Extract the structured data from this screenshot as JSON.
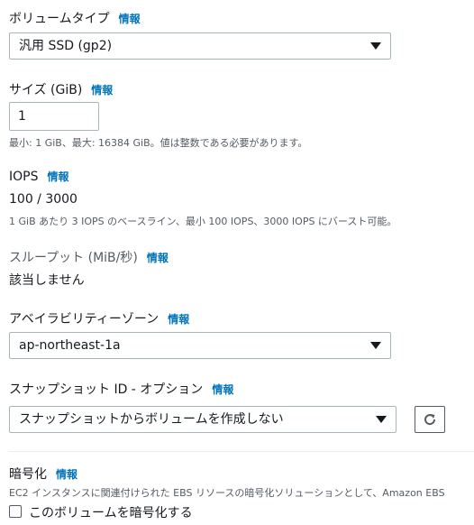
{
  "volume_type": {
    "label": "ボリュームタイプ",
    "info": "情報",
    "selected": "汎用 SSD (gp2)"
  },
  "size": {
    "label": "サイズ (GiB)",
    "info": "情報",
    "value": "1",
    "hint": "最小: 1 GiB、最大: 16384 GiB。値は整数である必要があります。"
  },
  "iops": {
    "label": "IOPS",
    "info": "情報",
    "value": "100 / 3000",
    "hint": "1 GiB あたり 3 IOPS のベースライン、最小 100 IOPS、3000 IOPS にバースト可能。"
  },
  "throughput": {
    "label": "スループット (MiB/秒)",
    "info": "情報",
    "value": "該当しません"
  },
  "availability_zone": {
    "label": "アベイラビリティーゾーン",
    "info": "情報",
    "selected": "ap-northeast-1a"
  },
  "snapshot": {
    "label": "スナップショット ID - オプション",
    "info": "情報",
    "selected": "スナップショットからボリュームを作成しない"
  },
  "encryption": {
    "label": "暗号化",
    "info": "情報",
    "hint": "EC2 インスタンスに関連付けられた EBS リソースの暗号化ソリューションとして、Amazon EBS",
    "checkbox_label": "このボリュームを暗号化する"
  }
}
